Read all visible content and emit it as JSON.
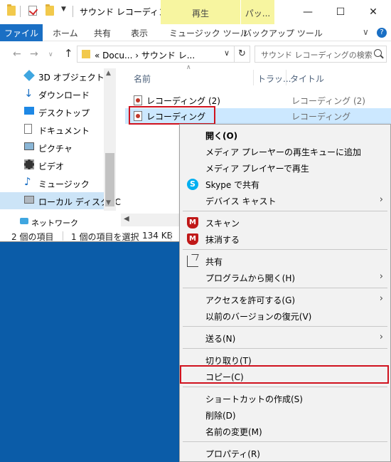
{
  "window": {
    "title": "サウンド レコーディング",
    "contextual_tabs": [
      "再生",
      "パッ..."
    ]
  },
  "ribbon": {
    "tabs": [
      "ファイル",
      "ホーム",
      "共有",
      "表示",
      "ミュージック ツール",
      "バックアップ ツール"
    ]
  },
  "address": {
    "path_prefix": "«",
    "path_part1": "Docu...",
    "path_sep": "›",
    "path_part2": "サウンド レ...",
    "search_placeholder": "サウンド レコーディングの検索"
  },
  "nav_pane": {
    "items": [
      "3D オブジェクト",
      "ダウンロード",
      "デスクトップ",
      "ドキュメント",
      "ピクチャ",
      "ビデオ",
      "ミュージック",
      "ローカル ディスク (C",
      "ネットワーク"
    ]
  },
  "file_list": {
    "columns": [
      "名前",
      "トラッ...",
      "タイトル"
    ],
    "rows": [
      {
        "name": "レコーディング (2)",
        "title": "レコーディング (2)"
      },
      {
        "name": "レコーディング",
        "title": "レコーディング"
      }
    ]
  },
  "status": {
    "count": "2 個の項目",
    "selected": "1 個の項目を選択",
    "size": "134 KB"
  },
  "context_menu": {
    "items": [
      "開く(O)",
      "メディア プレーヤーの再生キューに追加",
      "メディア プレイヤーで再生",
      "Skype で共有",
      "デバイス キャスト",
      "スキャン",
      "抹消する",
      "共有",
      "プログラムから開く(H)",
      "アクセスを許可する(G)",
      "以前のバージョンの復元(V)",
      "送る(N)",
      "切り取り(T)",
      "コピー(C)",
      "ショートカットの作成(S)",
      "削除(D)",
      "名前の変更(M)",
      "プロパティ(R)"
    ]
  },
  "colors": {
    "highlight_border": "#d0121e",
    "selection": "#cce8ff",
    "desktop": "#0b5ca8",
    "file_tab": "#1a6fc4",
    "contextual_tab": "#f7f5a0"
  }
}
